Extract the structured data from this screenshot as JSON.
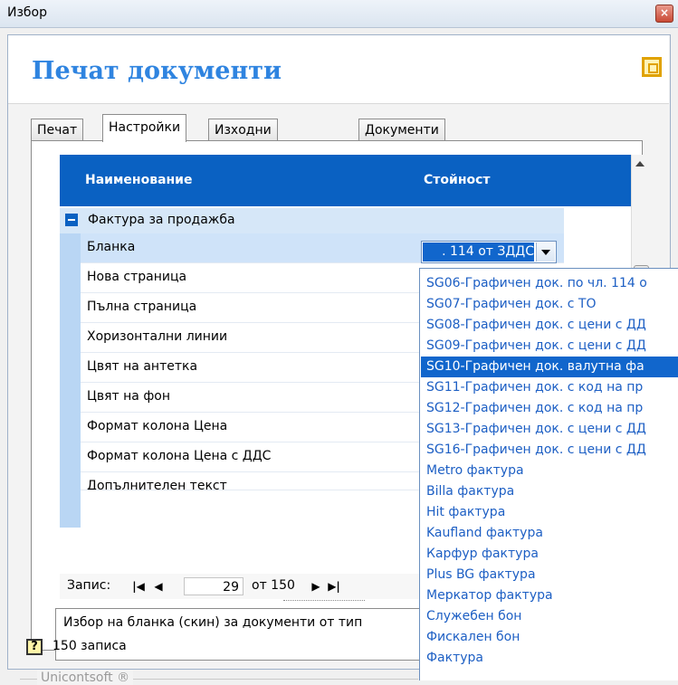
{
  "window": {
    "title": "Избор",
    "close_glyph": "×"
  },
  "header": {
    "title": "Печат документи"
  },
  "tabs": [
    {
      "label": "Печат"
    },
    {
      "label": "Настройки",
      "active": true
    },
    {
      "label": "Изходни справки"
    },
    {
      "label": "Документи"
    }
  ],
  "grid": {
    "columns": {
      "name": "Наименование",
      "value": "Стойност"
    },
    "group_label": "Фактура за продажба",
    "rows": [
      {
        "label": "Бланка"
      },
      {
        "label": "Нова страница"
      },
      {
        "label": "Пълна страница"
      },
      {
        "label": "Хоризонтални линии"
      },
      {
        "label": "Цвят на антетка"
      },
      {
        "label": "Цвят на фон"
      },
      {
        "label": "Формат колона Цена"
      },
      {
        "label": "Формат колона Цена с ДДС"
      },
      {
        "label": "Допълнителен текст"
      }
    ],
    "selected_value": ". 114 от ЗДДС"
  },
  "navigator": {
    "label": "Запис:",
    "first_glyph": "|◀",
    "prev_glyph": "◀",
    "current": "29",
    "of_text": "от 150",
    "next_glyph": "▶",
    "last_glyph": "▶|"
  },
  "description": "Избор на бланка (скин) за документи от тип",
  "footer": {
    "brand": "Unicontsoft ®",
    "record_count": "150 записа",
    "help_glyph": "?"
  },
  "dropdown_options": [
    {
      "label": "SG06-Графичен док. по чл. 114 о"
    },
    {
      "label": "SG07-Графичен док. с ТО"
    },
    {
      "label": "SG08-Графичен док. с цени с ДД"
    },
    {
      "label": "SG09-Графичен док. с цени с ДД"
    },
    {
      "label": "SG10-Графичен док. валутна фа",
      "highlighted": true
    },
    {
      "label": "SG11-Графичен док. с код на пр"
    },
    {
      "label": "SG12-Графичен док. с код на пр"
    },
    {
      "label": "SG13-Графичен док. с цени с ДД"
    },
    {
      "label": "SG16-Графичен док. с цени с ДД"
    },
    {
      "label": "Metro фактура"
    },
    {
      "label": "Billa фактура"
    },
    {
      "label": "Hit фактура"
    },
    {
      "label": "Kaufland фактура"
    },
    {
      "label": "Карфур фактура"
    },
    {
      "label": "Plus BG фактура"
    },
    {
      "label": "Меркатор фактура"
    },
    {
      "label": "Служебен бон"
    },
    {
      "label": "Фискален бон"
    },
    {
      "label": "Фактура"
    }
  ],
  "colors": {
    "accent": "#0a61c2",
    "title": "#2f84e0",
    "option_text": "#1d5fc4"
  }
}
